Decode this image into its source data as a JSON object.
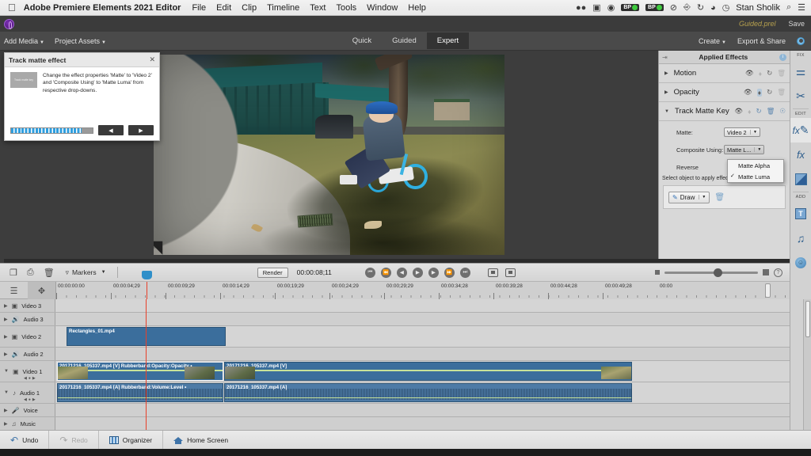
{
  "os_menubar": {
    "apple_icon": "apple-logo",
    "app_name": "Adobe Premiere Elements 2021 Editor",
    "menus": [
      "File",
      "Edit",
      "Clip",
      "Timeline",
      "Text",
      "Tools",
      "Window",
      "Help"
    ],
    "status_icons": [
      "dropbox-icon",
      "display-icon",
      "eye-icon",
      "battery-icon",
      "battery-icon",
      "nosign-icon",
      "airplay-icon",
      "timemachine-icon",
      "wifi-icon",
      "clock-icon"
    ],
    "battery_1_label": "BP",
    "battery_2_label": "BP",
    "user_name": "Stan Sholik",
    "search_icon": "search-icon",
    "control_center_icon": "control-center-icon"
  },
  "title_bar": {
    "logo": "premiere-elements-logo",
    "project_name": "Guided.prel",
    "save_label": "Save"
  },
  "toolbar": {
    "add_media_label": "Add Media",
    "project_assets_label": "Project Assets",
    "modes": [
      {
        "label": "Quick",
        "active": false
      },
      {
        "label": "Guided",
        "active": false
      },
      {
        "label": "Expert",
        "active": true
      }
    ],
    "create_label": "Create",
    "export_share_label": "Export & Share",
    "settings_icon": "gear-icon"
  },
  "guided_tip": {
    "title": "Track matte effect",
    "close_icon": "close-icon",
    "thumbnail_label": "Track matte key",
    "body": "Change the effect properties 'Matte' to 'Video 2' and 'Composite Using' to 'Matte Luma' from respective drop-downs.",
    "prev_label": "◀",
    "next_label": "▶"
  },
  "applied_effects": {
    "pin_icon": "pin-icon",
    "title": "Applied Effects",
    "info_icon": "info-icon",
    "effects": [
      {
        "name": "Motion",
        "expanded": false,
        "icons": [
          "eye-icon",
          "keyframe-icon",
          "reset-icon",
          "trash-icon"
        ]
      },
      {
        "name": "Opacity",
        "expanded": false,
        "icons": [
          "eye-icon",
          "keyframe-icon",
          "reset-icon",
          "trash-icon"
        ]
      },
      {
        "name": "Track Matte Key",
        "expanded": true,
        "icons": [
          "eye-icon",
          "keyframe-icon",
          "reset-icon",
          "trash-icon",
          "help-icon"
        ]
      }
    ],
    "properties": {
      "matte_label": "Matte:",
      "matte_value": "Video 2",
      "composite_label": "Composite Using:",
      "composite_value": "Matte L...",
      "reverse_label": "Reverse",
      "dropdown_options": [
        {
          "label": "Matte Alpha",
          "checked": false
        },
        {
          "label": "Matte Luma",
          "checked": true
        }
      ]
    },
    "hint_text": "Select object to apply effect",
    "draw_label": "Draw",
    "draw_icon": "pen-icon",
    "draw_caret": "▾",
    "delete_icon": "trash-icon"
  },
  "rail": {
    "groups": [
      {
        "label": "FIX",
        "icons": [
          "adjustments-icon",
          "tools-icon"
        ]
      },
      {
        "label": "EDIT",
        "icons": [
          "fx-pencil-icon",
          "fx-icon",
          "transitions-icon"
        ]
      },
      {
        "label": "ADD",
        "icons": [
          "text-icon",
          "music-icon",
          "graphics-icon"
        ]
      }
    ],
    "fix_label": "FIX",
    "edit_label": "EDIT",
    "add_label": "ADD"
  },
  "timeline_toolbar": {
    "icons": [
      "add-media-icon",
      "duplicate-icon",
      "delete-icon"
    ],
    "markers_label": "Markers",
    "markers_caret": "▾",
    "render_label": "Render",
    "timecode": "00:00:08;11",
    "transport": [
      "go-to-start-icon",
      "step-back-icon",
      "frame-back-icon",
      "play-icon",
      "frame-forward-icon",
      "step-forward-icon",
      "go-to-end-icon"
    ],
    "monitor_icons": [
      "preview-icon",
      "fullscreen-icon"
    ],
    "zoom_out_icon": "zoom-out-icon",
    "zoom_in_icon": "zoom-in-icon",
    "help_icon": "help-icon"
  },
  "ruler": {
    "header_icons": [
      "settings-icon",
      "move-icon"
    ],
    "ticks": [
      "00:00:00:00",
      "00:00:04;29",
      "00:00:09;29",
      "00:00:14;29",
      "00:00;19;29",
      "00:00;24;29",
      "00:00;29;29",
      "00:00:34;28",
      "00:00:39;28",
      "00:00:44;28",
      "00:00:49;28",
      "00:00"
    ]
  },
  "tracks": [
    {
      "name": "Video 3",
      "type": "video",
      "expanded": false
    },
    {
      "name": "Audio 3",
      "type": "audio",
      "expanded": false
    },
    {
      "name": "Video 2",
      "type": "video",
      "expanded": false
    },
    {
      "name": "Audio 2",
      "type": "audio",
      "expanded": false
    },
    {
      "name": "Video 1",
      "type": "video",
      "expanded": true
    },
    {
      "name": "Audio 1",
      "type": "audio",
      "expanded": true
    },
    {
      "name": "Voice",
      "type": "voice",
      "expanded": false
    },
    {
      "name": "Music",
      "type": "music",
      "expanded": false
    }
  ],
  "clips": {
    "video2": {
      "label": "Rectangles_01.mp4"
    },
    "video1_a": {
      "label": "20171216_105337.mp4 [V] Rubberband:Opacity:Opacity •"
    },
    "video1_b": {
      "label": "20171216_105337.mp4 [V]"
    },
    "audio1_a": {
      "label": "20171216_105337.mp4 [A] Rubberband:Volume:Level •"
    },
    "audio1_b": {
      "label": "20171216_105337.mp4 [A]"
    }
  },
  "bottom_bar": {
    "undo_label": "Undo",
    "undo_icon": "undo-icon",
    "redo_label": "Redo",
    "redo_icon": "redo-icon",
    "organizer_label": "Organizer",
    "organizer_icon": "organizer-icon",
    "home_label": "Home Screen",
    "home_icon": "home-icon"
  },
  "colors": {
    "accent_blue": "#3b6e9c",
    "playhead_red": "#e8402a",
    "rubberband_green": "#c7e39a",
    "title_gold": "#b6a04e"
  }
}
